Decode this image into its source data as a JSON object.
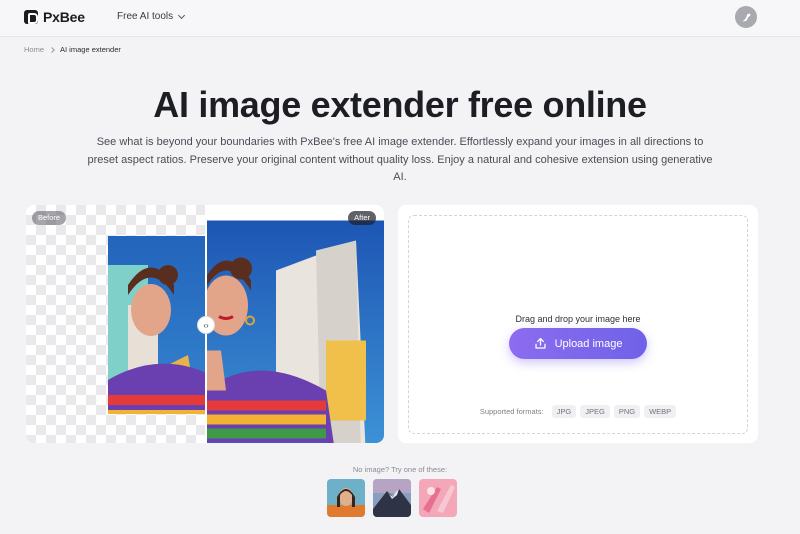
{
  "header": {
    "logo_text": "PxBee",
    "nav_tools_label": "Free AI tools"
  },
  "breadcrumb": {
    "home": "Home",
    "current": "AI image extender"
  },
  "hero": {
    "title": "AI image extender free online",
    "subtitle": "See what is beyond your boundaries with PxBee's free AI image extender. Effortlessly expand your images in all directions to preset aspect ratios. Preserve your original content without quality loss. Enjoy a natural and cohesive extension using generative AI."
  },
  "compare": {
    "before_label": "Before",
    "after_label": "After",
    "handle_glyph": "‹›"
  },
  "upload": {
    "drop_text": "Drag and drop your image here",
    "button_label": "Upload image",
    "formats_label": "Supported formats:",
    "formats": [
      "JPG",
      "JPEG",
      "PNG",
      "WEBP"
    ]
  },
  "samples": {
    "label": "No image? Try one of these:",
    "items": [
      "woman-portrait",
      "mountain-landscape",
      "pink-cosmetics"
    ]
  },
  "colors": {
    "accent": "#7a66ee",
    "background": "#f3f3f6"
  }
}
